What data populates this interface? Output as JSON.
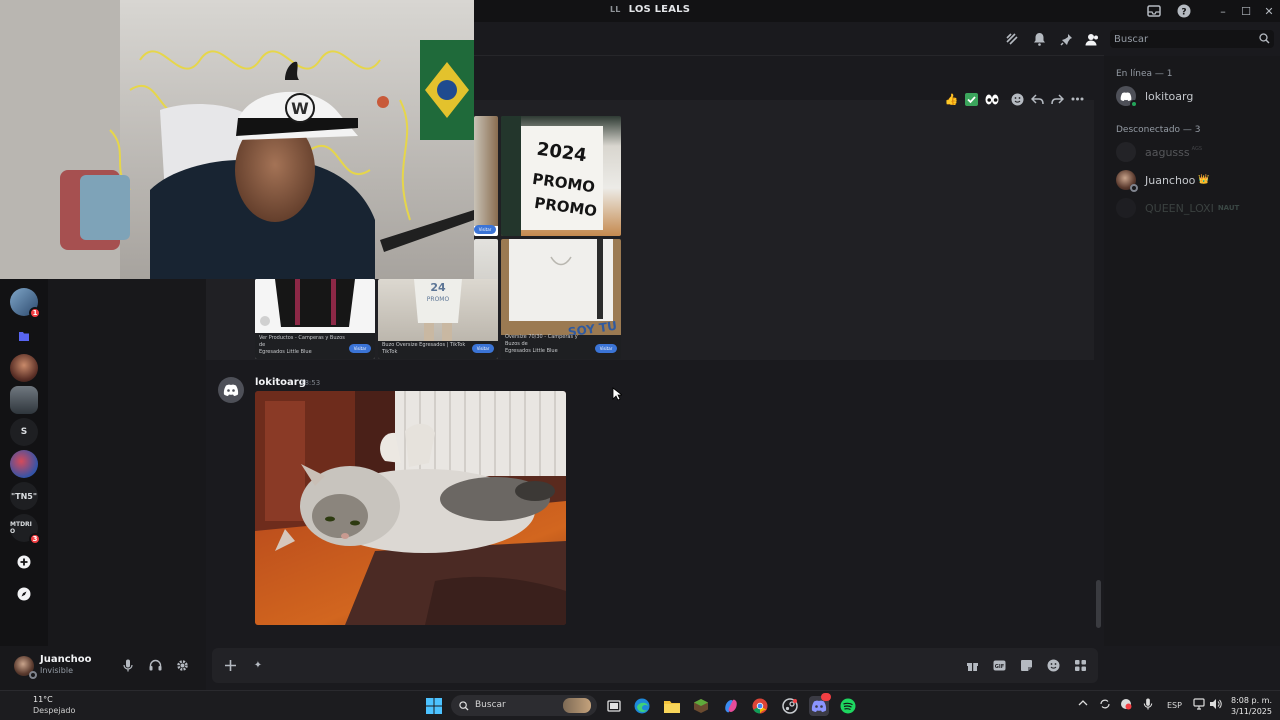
{
  "titlebar": {
    "initials": "LL",
    "server_name": "LOS LEALS"
  },
  "header": {
    "search_placeholder": "Buscar"
  },
  "rail": {
    "items": [
      {
        "label": "",
        "badge": "1"
      },
      {
        "label": ""
      },
      {
        "label": ""
      },
      {
        "label": ""
      },
      {
        "label": "S"
      },
      {
        "label": ""
      },
      {
        "label": "\"TN5\""
      },
      {
        "label": "MTDRI O",
        "badge": "3"
      }
    ]
  },
  "message_hover_actions": [
    "thumbs-up",
    "check",
    "eyes",
    "add-reaction",
    "reply",
    "forward",
    "more"
  ],
  "attachments": [
    {
      "caption_line1": "Ver Productos - Camperas y Buzos de",
      "caption_line2": "Egresados Little Blue",
      "button": "Visitar"
    },
    {
      "caption_line1": "Buzo Oversize Egresados | TikTok",
      "caption_line2": "TikTok",
      "button": "Visitar"
    },
    {
      "caption_line1": "Oversize 70/30 - Camperas y Buzos de",
      "caption_line2": "Egresados Little Blue",
      "button": "Visitar"
    }
  ],
  "attachment_tags": [
    "Visitar",
    "Visitar"
  ],
  "message": {
    "author": "lokitoarg",
    "time": "18:53"
  },
  "members": {
    "online_header": "En línea — 1",
    "online": [
      {
        "name": "lokitoarg"
      }
    ],
    "offline_header": "Desconectado — 3",
    "offline": [
      {
        "name": "aagusss",
        "tag": "AGS"
      },
      {
        "name": "Juanchoo",
        "crown": "👑"
      },
      {
        "name": "QUEEN_LOXI",
        "tag": "NAUT"
      }
    ]
  },
  "user_panel": {
    "username": "Juanchoo",
    "status": "Invisible"
  },
  "taskbar": {
    "temperature": "11°C",
    "condition": "Despejado",
    "search_label": "Buscar",
    "language": "ESP",
    "time": "8:08 p. m.",
    "date": "3/11/2025"
  },
  "colors": {
    "accent": "#5865f2",
    "online": "#23a55a",
    "danger": "#f23f43",
    "bg": "#1a1a1e"
  }
}
